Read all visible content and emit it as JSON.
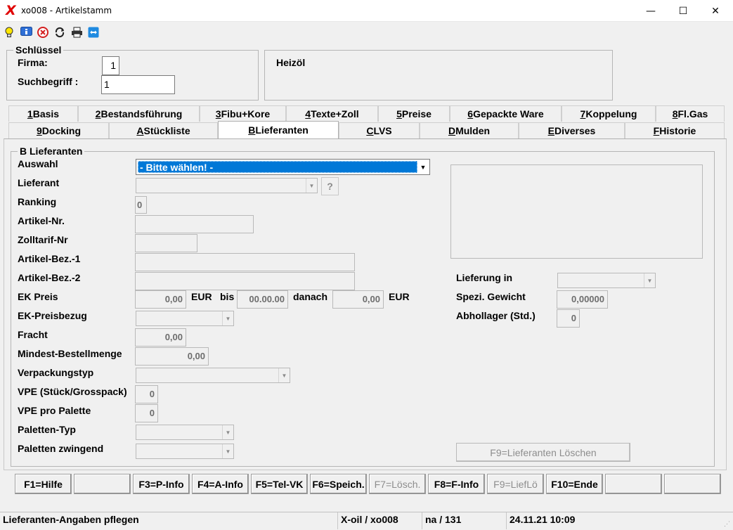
{
  "window": {
    "title": "xo008 - Artikelstamm",
    "logo": "X",
    "minimize": "—",
    "maximize": "☐",
    "close": "✕"
  },
  "toolbar": {
    "icons": [
      "lightbulb-icon",
      "info-icon",
      "cancel-icon",
      "refresh-icon",
      "print-icon",
      "teamviewer-icon"
    ]
  },
  "key": {
    "legend": "Schlüssel",
    "firma_label": "Firma:",
    "firma_value": "1",
    "search_label": "Suchbegriff :",
    "search_value": "1"
  },
  "product_name": "Heizöl",
  "tabs_row1": [
    {
      "key": "1",
      "label": " Basis"
    },
    {
      "key": "2",
      "label": " Bestandsführung"
    },
    {
      "key": "3",
      "label": " Fibu+Kore"
    },
    {
      "key": "4",
      "label": " Texte+Zoll"
    },
    {
      "key": "5",
      "label": " Preise"
    },
    {
      "key": "6",
      "label": " Gepackte Ware"
    },
    {
      "key": "7",
      "label": " Koppelung"
    },
    {
      "key": "8",
      "label": " Fl.Gas"
    }
  ],
  "tabs_row2": [
    {
      "key": "9",
      "label": " Docking"
    },
    {
      "key": "A",
      "label": " Stückliste"
    },
    {
      "key": "B",
      "label": " Lieferanten"
    },
    {
      "key": "C",
      "label": " LVS"
    },
    {
      "key": "D",
      "label": " Mulden"
    },
    {
      "key": "E",
      "label": " Diverses"
    },
    {
      "key": "F",
      "label": " Historie"
    }
  ],
  "section": {
    "legend": "B Lieferanten",
    "auswahl_label": "Auswahl",
    "auswahl_value": "- Bitte wählen! -",
    "lieferant_label": "Lieferant",
    "lieferant_help": "?",
    "ranking_label": "Ranking",
    "ranking_value": "0",
    "artikelnr_label": "Artikel-Nr.",
    "zolltarif_label": "Zolltarif-Nr",
    "bez1_label": "Artikel-Bez.-1",
    "bez2_label": "Artikel-Bez.-2",
    "ekpreis_label": "EK Preis",
    "ekpreis_value": "0,00",
    "eur1": "EUR",
    "bis": "bis",
    "date_value": "00.00.00",
    "danach": "danach",
    "danach_value": "0,00",
    "eur2": "EUR",
    "ekbezug_label": "EK-Preisbezug",
    "fracht_label": "Fracht",
    "fracht_value": "0,00",
    "mindest_label": "Mindest-Bestellmenge",
    "mindest_value": "0,00",
    "verpackung_label": "Verpackungstyp",
    "vpe_label": "VPE (Stück/Grosspack)",
    "vpe_value": "0",
    "vpe_palette_label": "VPE pro Palette",
    "vpe_palette_value": "0",
    "paletten_typ_label": "Paletten-Typ",
    "paletten_zwingend_label": "Paletten zwingend",
    "lieferung_label": "Lieferung in",
    "gewicht_label": "Spezi. Gewicht",
    "gewicht_value": "0,00000",
    "abhol_label": "Abhollager (Std.)",
    "abhol_value": "0",
    "delete_button": "F9=Lieferanten Löschen"
  },
  "fkeys": [
    "F1=Hilfe",
    "",
    "F3=P-Info",
    "F4=A-Info",
    "F5=Tel-VK",
    "F6=Speich.",
    "F7=Lösch.",
    "F8=F-Info",
    "F9=LiefLö",
    "F10=Ende",
    "",
    ""
  ],
  "status": {
    "message": "Lieferanten-Angaben pflegen",
    "program": "X-oil / xo008",
    "user": "na / 131",
    "datetime": "24.11.21 10:09"
  }
}
